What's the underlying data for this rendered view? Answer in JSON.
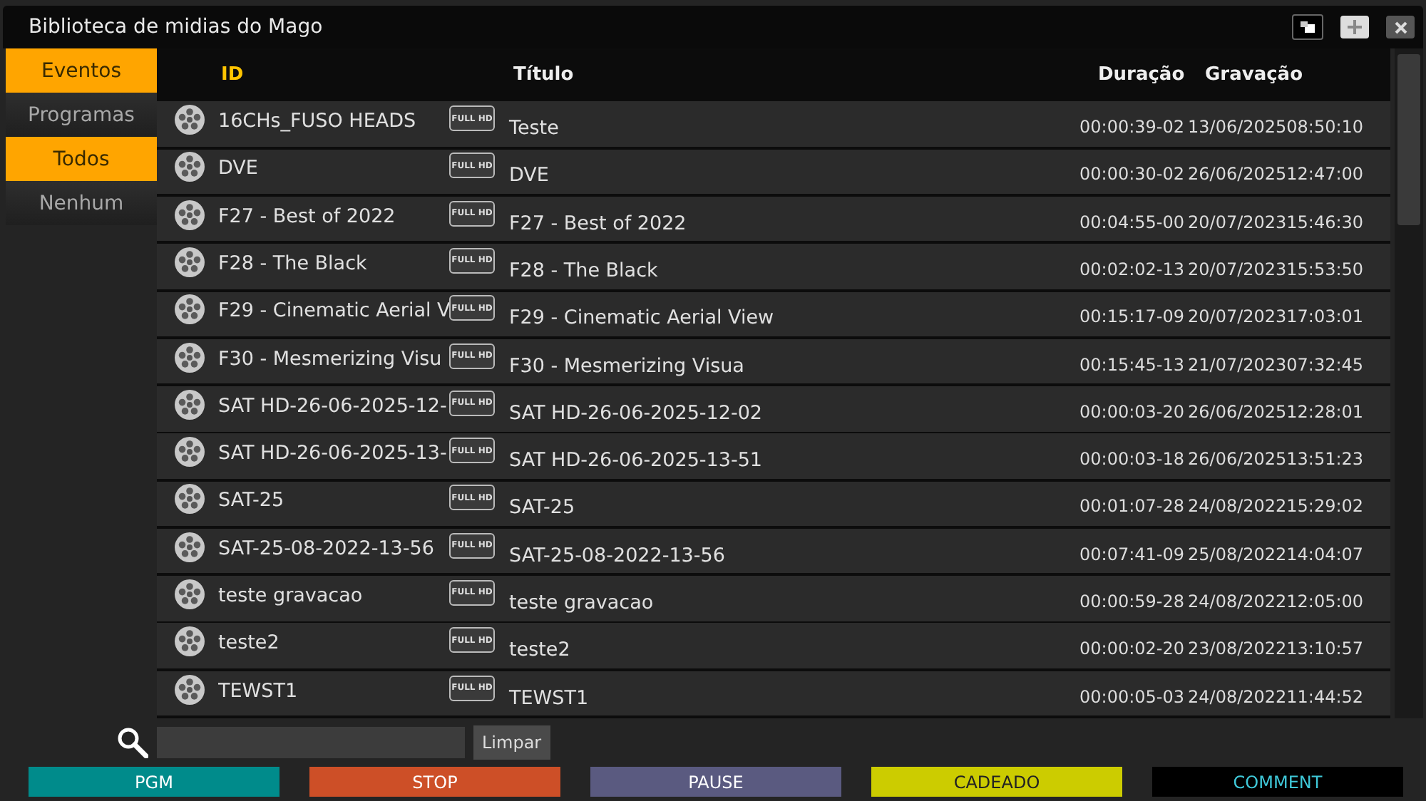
{
  "window": {
    "title": "Biblioteca de midias do Mago"
  },
  "sidebar": {
    "items": [
      {
        "label": "Eventos",
        "selected": true
      },
      {
        "label": "Programas",
        "selected": false
      },
      {
        "label": "Todos",
        "selected": true
      },
      {
        "label": "Nenhum",
        "selected": false
      }
    ]
  },
  "table": {
    "columns": [
      "ID",
      "Título",
      "Duração",
      "Gravação"
    ],
    "rows": [
      {
        "id": "16CHs_FUSO HEADS",
        "badge": "FULL HD",
        "title": "Teste",
        "duration": "00:00:39-02",
        "recorded": "13/06/202508:50:10"
      },
      {
        "id": "DVE",
        "badge": "FULL HD",
        "title": "DVE",
        "duration": "00:00:30-02",
        "recorded": "26/06/202512:47:00"
      },
      {
        "id": "F27 - Best of 2022",
        "badge": "FULL HD",
        "title": "F27 - Best of 2022",
        "duration": "00:04:55-00",
        "recorded": "20/07/202315:46:30"
      },
      {
        "id": "F28 - The Black",
        "badge": "FULL HD",
        "title": "F28 - The Black",
        "duration": "00:02:02-13",
        "recorded": "20/07/202315:53:50"
      },
      {
        "id": "F29 - Cinematic Aerial V",
        "badge": "FULL HD",
        "title": "F29 - Cinematic Aerial View",
        "duration": "00:15:17-09",
        "recorded": "20/07/202317:03:01"
      },
      {
        "id": "F30 -  Mesmerizing Visu",
        "badge": "FULL HD",
        "title": "F30 -  Mesmerizing Visua",
        "duration": "00:15:45-13",
        "recorded": "21/07/202307:32:45"
      },
      {
        "id": "SAT HD-26-06-2025-12-",
        "badge": "FULL HD",
        "title": "SAT HD-26-06-2025-12-02",
        "duration": "00:00:03-20",
        "recorded": "26/06/202512:28:01"
      },
      {
        "id": "SAT HD-26-06-2025-13-",
        "badge": "FULL HD",
        "title": "SAT HD-26-06-2025-13-51",
        "duration": "00:00:03-18",
        "recorded": "26/06/202513:51:23"
      },
      {
        "id": "SAT-25",
        "badge": "FULL HD",
        "title": "SAT-25",
        "duration": "00:01:07-28",
        "recorded": "24/08/202215:29:02"
      },
      {
        "id": "SAT-25-08-2022-13-56",
        "badge": "FULL HD",
        "title": "SAT-25-08-2022-13-56",
        "duration": "00:07:41-09",
        "recorded": "25/08/202214:04:07"
      },
      {
        "id": "teste gravacao",
        "badge": "FULL HD",
        "title": "teste gravacao",
        "duration": "00:00:59-28",
        "recorded": "24/08/202212:05:00"
      },
      {
        "id": "teste2",
        "badge": "FULL HD",
        "title": "teste2",
        "duration": "00:00:02-20",
        "recorded": "23/08/202213:10:57"
      },
      {
        "id": "TEWST1",
        "badge": "FULL HD",
        "title": "TEWST1",
        "duration": "00:00:05-03",
        "recorded": "24/08/202211:44:52"
      }
    ]
  },
  "search": {
    "button": "Limpar"
  },
  "actions": [
    {
      "label": "PGM",
      "color": "#008b8b"
    },
    {
      "label": "STOP",
      "color": "#cd4f27"
    },
    {
      "label": "PAUSE",
      "color": "#5a5a80"
    },
    {
      "label": "CADEADO",
      "color": "#cccc00"
    },
    {
      "label": "COMMENT",
      "color": "#000000"
    }
  ]
}
